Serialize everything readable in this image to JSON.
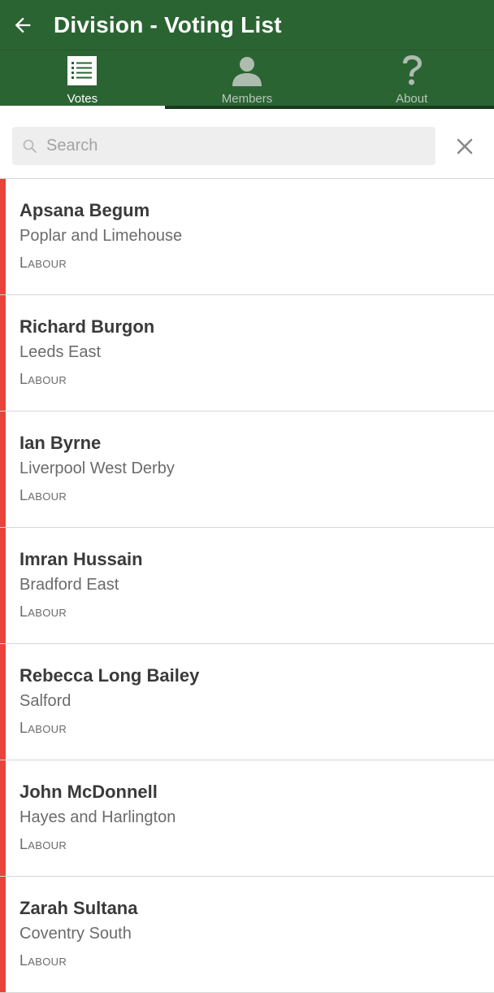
{
  "app_bar": {
    "title": "Division - Voting List",
    "back_icon": "arrow-left-icon",
    "background": "#2b6433"
  },
  "tabs": [
    {
      "label": "Votes",
      "icon": "list-icon",
      "active": true
    },
    {
      "label": "Members",
      "icon": "person-icon",
      "active": false
    },
    {
      "label": "About",
      "icon": "question-icon",
      "active": false
    }
  ],
  "search": {
    "placeholder": "Search",
    "value": "",
    "clear_icon": "close-icon"
  },
  "vote_color": "#e8443c",
  "members": [
    {
      "name": "Apsana Begum",
      "constituency": "Poplar and Limehouse",
      "party": "Labour"
    },
    {
      "name": "Richard Burgon",
      "constituency": "Leeds East",
      "party": "Labour"
    },
    {
      "name": "Ian Byrne",
      "constituency": "Liverpool West Derby",
      "party": "Labour"
    },
    {
      "name": "Imran Hussain",
      "constituency": "Bradford East",
      "party": "Labour"
    },
    {
      "name": "Rebecca Long Bailey",
      "constituency": "Salford",
      "party": "Labour"
    },
    {
      "name": "John McDonnell",
      "constituency": "Hayes and Harlington",
      "party": "Labour"
    },
    {
      "name": "Zarah Sultana",
      "constituency": "Coventry South",
      "party": "Labour"
    }
  ]
}
